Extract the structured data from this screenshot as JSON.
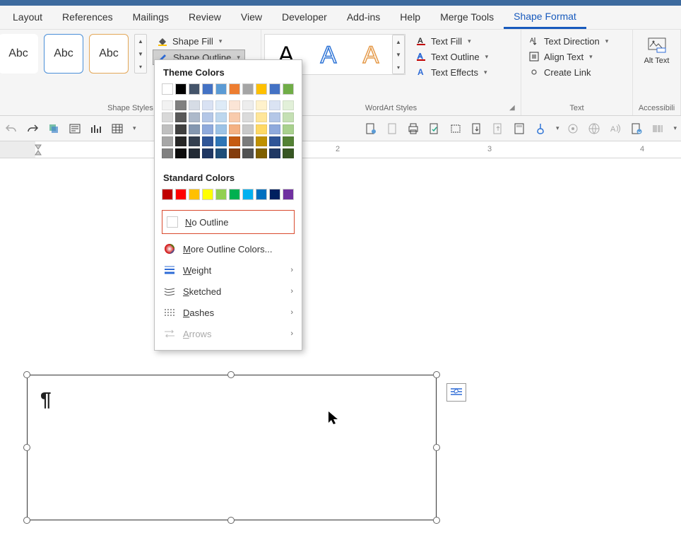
{
  "tabs": [
    "Layout",
    "References",
    "Mailings",
    "Review",
    "View",
    "Developer",
    "Add-ins",
    "Help",
    "Merge Tools",
    "Shape Format"
  ],
  "active_tab": 9,
  "ribbon": {
    "shape_styles": {
      "tile_label": "Abc",
      "shape_fill": "Shape Fill",
      "shape_outline": "Shape Outline",
      "group": "Shape Styles"
    },
    "wordart": {
      "group": "WordArt Styles",
      "text_fill": "Text Fill",
      "text_outline": "Text Outline",
      "text_effects": "Text Effects"
    },
    "text": {
      "group": "Text",
      "direction": "Text Direction",
      "align": "Align Text",
      "link": "Create Link"
    },
    "accessibility": {
      "group": "Accessibili",
      "alt_text": "Alt Text"
    }
  },
  "dropdown": {
    "theme_heading": "Theme Colors",
    "theme_row": [
      "#ffffff",
      "#000000",
      "#44546a",
      "#4472c4",
      "#5b9bd5",
      "#ed7d31",
      "#a5a5a5",
      "#ffc000",
      "#4472c4",
      "#70ad47"
    ],
    "shade_cols": [
      [
        "#f2f2f2",
        "#d9d9d9",
        "#bfbfbf",
        "#a6a6a6",
        "#808080"
      ],
      [
        "#808080",
        "#595959",
        "#404040",
        "#262626",
        "#0d0d0d"
      ],
      [
        "#d6dce5",
        "#adb9ca",
        "#8497b0",
        "#333f50",
        "#222a35"
      ],
      [
        "#d9e2f3",
        "#b4c7e7",
        "#8faadc",
        "#2f5597",
        "#203864"
      ],
      [
        "#deebf7",
        "#bdd7ee",
        "#9dc3e6",
        "#2e75b6",
        "#1f4e79"
      ],
      [
        "#fbe5d6",
        "#f8cbad",
        "#f4b183",
        "#c55a11",
        "#843c0c"
      ],
      [
        "#ededed",
        "#dbdbdb",
        "#c9c9c9",
        "#7b7b7b",
        "#525252"
      ],
      [
        "#fff2cc",
        "#ffe699",
        "#ffd966",
        "#bf9000",
        "#7f6000"
      ],
      [
        "#dae3f3",
        "#b4c7e7",
        "#8faadc",
        "#2f5597",
        "#1f3864"
      ],
      [
        "#e2f0d9",
        "#c5e0b4",
        "#a9d18e",
        "#548235",
        "#385723"
      ]
    ],
    "standard_heading": "Standard Colors",
    "standard_row": [
      "#c00000",
      "#ff0000",
      "#ffc000",
      "#ffff00",
      "#92d050",
      "#00b050",
      "#00b0f0",
      "#0070c0",
      "#002060",
      "#7030a0"
    ],
    "no_outline": "No Outline",
    "more_colors": "More Outline Colors...",
    "weight": "Weight",
    "sketched": "Sketched",
    "dashes": "Dashes",
    "arrows": "Arrows"
  },
  "ruler": {
    "nums": [
      "2",
      "3",
      "4"
    ],
    "positions": [
      475,
      690,
      906
    ]
  },
  "shape": {
    "paragraph": "¶"
  }
}
